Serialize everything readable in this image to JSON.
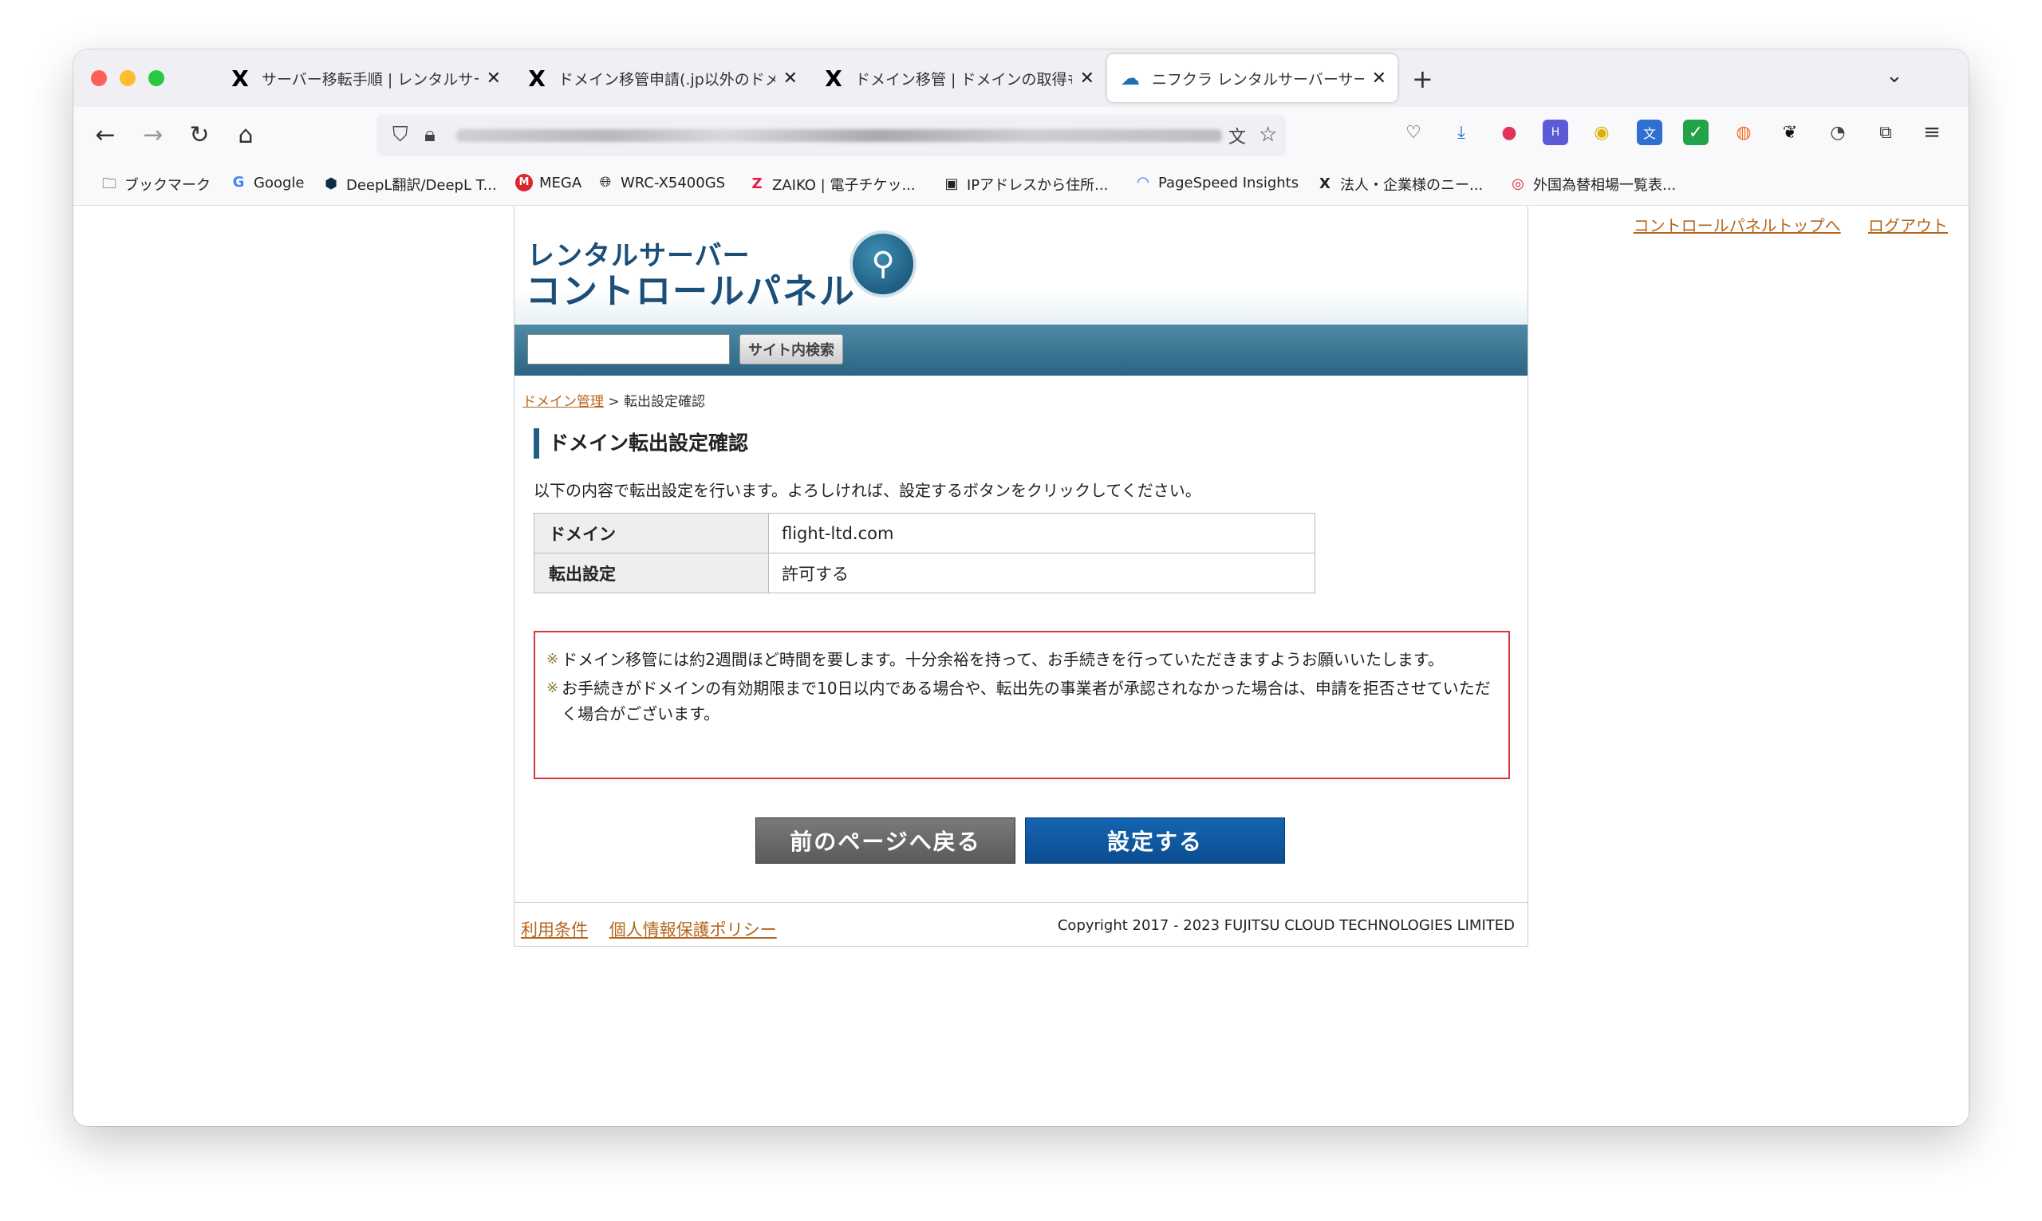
{
  "tabs": [
    {
      "title": "サーバー移転手順 | レンタルサー…",
      "icon": "x-logo-icon"
    },
    {
      "title": "ドメイン移管申請(.jp以外のドメ…",
      "icon": "x-logo-icon"
    },
    {
      "title": "ドメイン移管 | ドメインの取得も…",
      "icon": "x-logo-icon"
    },
    {
      "title": "ニフクラ レンタルサーバーサービ…",
      "icon": "cloud-icon"
    }
  ],
  "bookmarks": [
    {
      "label": "ブックマーク"
    },
    {
      "label": "Google"
    },
    {
      "label": "DeepL翻訳/DeepL T..."
    },
    {
      "label": "MEGA"
    },
    {
      "label": "WRC-X5400GS"
    },
    {
      "label": "ZAIKO | 電子チケッ..."
    },
    {
      "label": "IPアドレスから住所..."
    },
    {
      "label": "PageSpeed Insights"
    },
    {
      "label": "法人・企業様のニー..."
    },
    {
      "label": "外国為替相場一覧表..."
    }
  ],
  "toplinks": {
    "cp_top": "コントロールパネルトップへ",
    "logout": "ログアウト"
  },
  "logo": {
    "line1": "レンタルサーバー",
    "line2": "コントロールパネル"
  },
  "search": {
    "button": "サイト内検索",
    "value": ""
  },
  "breadcrumb": {
    "parent": "ドメイン管理",
    "sep": " > ",
    "current": "転出設定確認"
  },
  "page": {
    "heading": "ドメイン転出設定確認",
    "intro": "以下の内容で転出設定を行います。よろしければ、設定するボタンをクリックしてください。"
  },
  "table": [
    {
      "label": "ドメイン",
      "value": "flight-ltd.com"
    },
    {
      "label": "転出設定",
      "value": "許可する"
    }
  ],
  "notice": {
    "mark": "※",
    "items": [
      "ドメイン移管には約2週間ほど時間を要します。十分余裕を持って、お手続きを行っていただきますようお願いいたします。",
      "お手続きがドメインの有効期限まで10日以内である場合や、転出先の事業者が承認されなかった場合は、申請を拒否させていただく場合がございます。"
    ]
  },
  "buttons": {
    "back": "前のページへ戻る",
    "submit": "設定する"
  },
  "footer": {
    "terms": "利用条件",
    "privacy": "個人情報保護ポリシー",
    "copyright": "Copyright 2017 - 2023 FUJITSU CLOUD TECHNOLOGIES LIMITED"
  }
}
